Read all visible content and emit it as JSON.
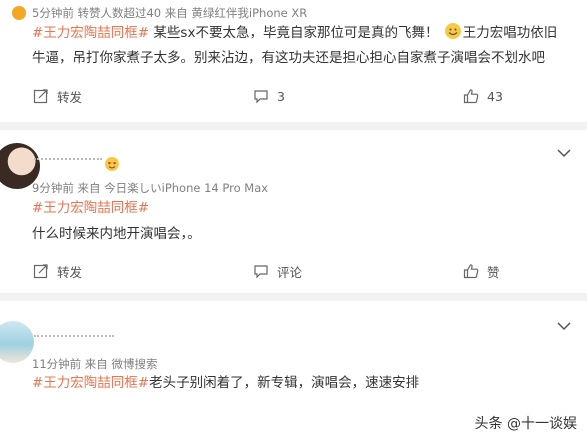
{
  "posts": [
    {
      "meta": "5分钟前  转赞人数超过40  来自 黄绿红伴我iPhone XR",
      "tag": "#王力宏陶喆同框#",
      "line1_rest": " 某些sx不要太急，毕竟自家那位可是真的飞舞！",
      "line1_tail": "王力宏唱功依旧",
      "line2": "牛逼，吊打你家煮子太多。别来沾边，有这功夫还是担心担心自家煮子演唱会不划水吧",
      "actions": {
        "repost": "转发",
        "comment": "3",
        "like": "43"
      }
    },
    {
      "meta": "9分钟前  来自 今日楽しいiPhone 14 Pro Max",
      "tag": "#王力宏陶喆同框#",
      "text": "什么时候来内地开演唱会，。",
      "actions": {
        "repost": "转发",
        "comment": "评论",
        "like": "赞"
      }
    },
    {
      "meta": "11分钟前  来自 微博搜索",
      "tag": "#王力宏陶喆同框#",
      "text_rest": "老头子别闲着了，新专辑，演唱会，速速安排"
    }
  ],
  "watermark": "头条 @十一谈娱",
  "icons": [
    "repost-icon",
    "comment-icon",
    "like-icon",
    "chevron-down-icon",
    "grin-emoji-icon",
    "heart-eyes-emoji-icon",
    "vip-badge-icon"
  ],
  "colors": {
    "tag": "#eb7350",
    "meta": "#808080",
    "separator": "#f2f2f2"
  }
}
